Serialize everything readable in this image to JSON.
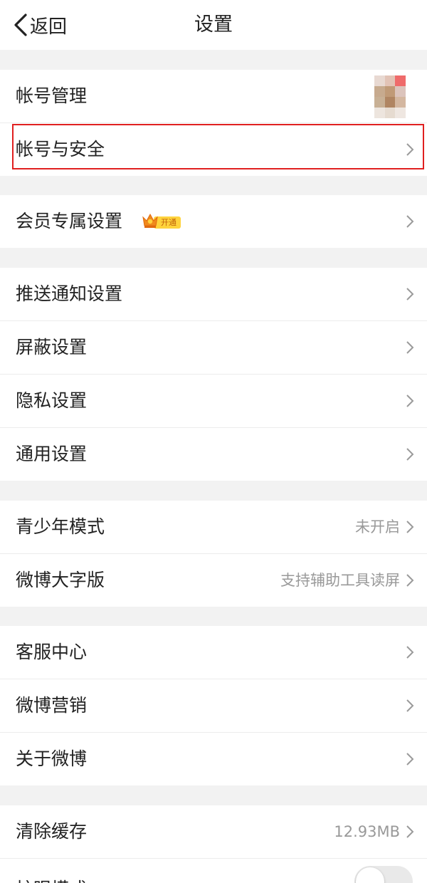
{
  "navbar": {
    "back_label": "返回",
    "title": "设置"
  },
  "rows": {
    "account_manage": {
      "label": "帐号管理"
    },
    "account_security": {
      "label": "帐号与安全"
    },
    "member_settings": {
      "label": "会员专属设置",
      "badge": "开通"
    },
    "push_settings": {
      "label": "推送通知设置"
    },
    "block_settings": {
      "label": "屏蔽设置"
    },
    "privacy_settings": {
      "label": "隐私设置"
    },
    "general_settings": {
      "label": "通用设置"
    },
    "youth_mode": {
      "label": "青少年模式",
      "value": "未开启"
    },
    "large_font": {
      "label": "微博大字版",
      "value": "支持辅助工具读屏"
    },
    "customer_service": {
      "label": "客服中心"
    },
    "weibo_marketing": {
      "label": "微博营销"
    },
    "about_weibo": {
      "label": "关于微博"
    },
    "clear_cache": {
      "label": "清除缓存",
      "value": "12.93MB"
    },
    "eye_mode": {
      "label": "护眼模式",
      "enabled": false
    }
  },
  "icons": {
    "back": "chevron-left-icon",
    "row_arrow": "chevron-right-icon",
    "badge": "crown-icon"
  },
  "colors": {
    "highlight": "#e02020",
    "badge_bg": "#ffd33d",
    "secondary_text": "#999999",
    "section_gap": "#f2f2f2"
  }
}
